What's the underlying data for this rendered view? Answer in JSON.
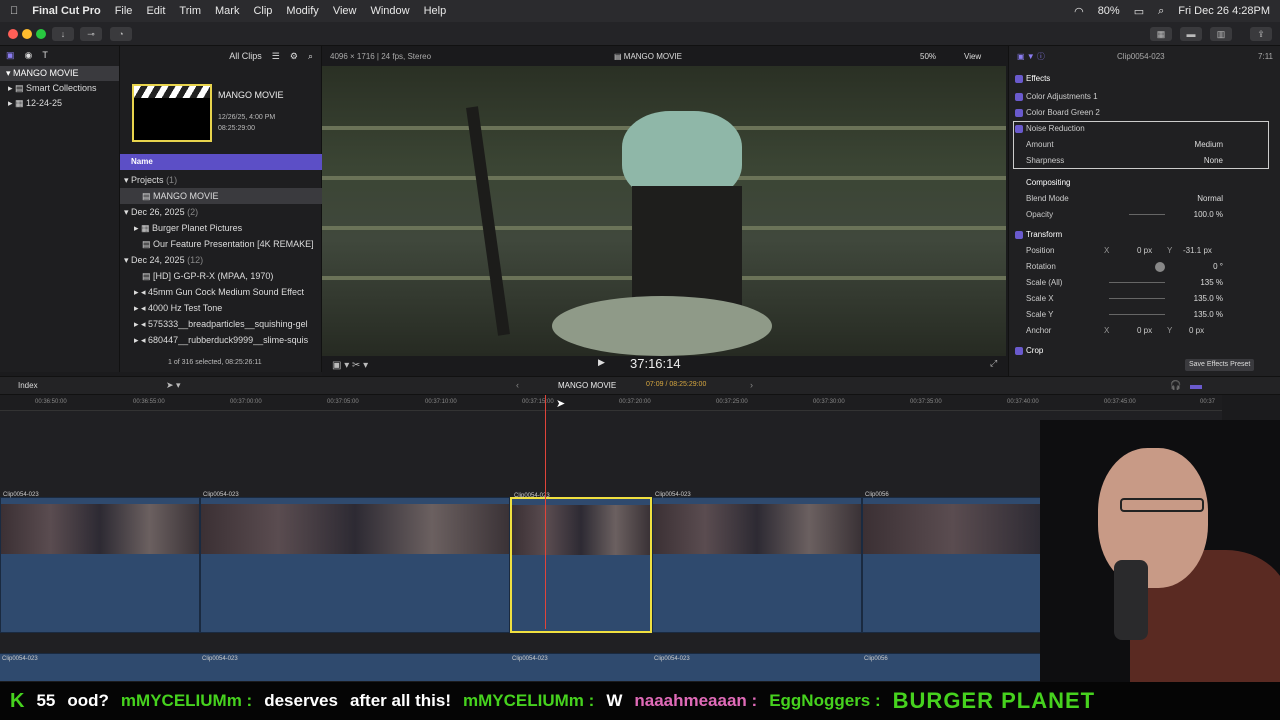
{
  "menubar": {
    "app": "Final Cut Pro",
    "items": [
      "File",
      "Edit",
      "Trim",
      "Mark",
      "Clip",
      "Modify",
      "View",
      "Window",
      "Help"
    ],
    "battery": "80%",
    "datetime": "Fri Dec 26  4:28PM"
  },
  "sidebar": {
    "library": "MANGO MOVIE",
    "items": [
      "Smart Collections",
      "12-24-25"
    ]
  },
  "browser": {
    "filter": "All Clips",
    "project_title": "MANGO MOVIE",
    "project_date": "12/26/25, 4:00 PM",
    "project_duration": "08:25:29:00",
    "col_name": "Name",
    "groups": [
      {
        "label": "Projects",
        "count": "(1)",
        "rows": [
          "MANGO MOVIE"
        ]
      },
      {
        "label": "Dec 26, 2025",
        "count": "(2)",
        "rows": [
          "Burger Planet Pictures",
          "Our Feature Presentation [4K REMAKE]"
        ]
      },
      {
        "label": "Dec 24, 2025",
        "count": "(12)",
        "rows": [
          "[HD] G-GP-R-X (MPAA, 1970)",
          "45mm Gun Cock Medium Sound Effect",
          "4000 Hz Test Tone",
          "575333__breadparticles__squishing-gel",
          "680447__rubberduck9999__slime-squis"
        ]
      }
    ],
    "status": "1 of 316 selected, 08:25:26:11"
  },
  "viewer": {
    "format": "4096 × 1716 | 24 fps, Stereo",
    "title": "MANGO MOVIE",
    "zoom": "50%",
    "view": "View",
    "timecode": "37:16:14"
  },
  "inspector": {
    "clip": "Clip0054-023",
    "dur": "7:11",
    "effects": "Effects",
    "color_adj": "Color Adjustments 1",
    "color_board": "Color Board Green 2",
    "noise": "Noise Reduction",
    "amount_l": "Amount",
    "amount_v": "Medium",
    "sharp_l": "Sharpness",
    "sharp_v": "None",
    "compositing": "Compositing",
    "blend_l": "Blend Mode",
    "blend_v": "Normal",
    "opacity_l": "Opacity",
    "opacity_v": "100.0  %",
    "transform": "Transform",
    "position_l": "Position",
    "pos_x": "0  px",
    "pos_y": "-31.1  px",
    "rotation_l": "Rotation",
    "rotation_v": "0  °",
    "scale_all_l": "Scale (All)",
    "scale_all_v": "135  %",
    "scale_x_l": "Scale X",
    "scale_x_v": "135.0  %",
    "scale_y_l": "Scale Y",
    "scale_y_v": "135.0  %",
    "anchor_l": "Anchor",
    "anchor_x": "0  px",
    "anchor_y": "0  px",
    "crop": "Crop",
    "save_preset": "Save Effects Preset",
    "x": "X",
    "y": "Y"
  },
  "timeline": {
    "index": "Index",
    "project": "MANGO MOVIE",
    "tc": "07:09 / 08:25:29:00",
    "ticks": [
      "00:36:50:00",
      "00:36:55:00",
      "00:37:00:00",
      "00:37:05:00",
      "00:37:10:00",
      "00:37:15:00",
      "00:37:20:00",
      "00:37:25:00",
      "00:37:30:00",
      "00:37:35:00",
      "00:37:40:00",
      "00:37:45:00",
      "00:37"
    ],
    "clips": [
      "Clip0054-023",
      "Clip0054-023",
      "Clip0054-023",
      "Clip0054-023",
      "Clip0056"
    ]
  },
  "chat": {
    "count": "55",
    "segments": [
      "ood?",
      "mMYCELIUMm :",
      "deserves",
      "after all this!",
      "mMYCELIUMm :",
      "W",
      "naaahmeaaan :",
      "EggNoggers :",
      "BURGER PLANET"
    ]
  }
}
